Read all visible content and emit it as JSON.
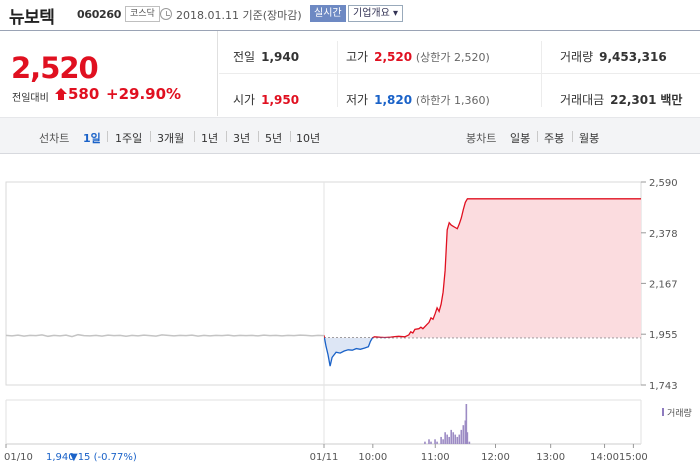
{
  "header": {
    "stock_name": "뉴보텍",
    "stock_code": "060260",
    "market": "코스닥",
    "date_text": "2018.01.11  기준(장마감)",
    "realtime_label": "실시간",
    "company_info_label": "기업개요",
    "company_info_arrow": "▾"
  },
  "summary": {
    "current_price": "2,520",
    "compare_label": "전일대비",
    "change": "580",
    "change_pct": "+29.90%",
    "prev_label": "전일",
    "prev_value": "1,940",
    "high_label": "고가",
    "high_value": "2,520",
    "high_limit": "(상한가 2,520)",
    "volume_label": "거래량",
    "volume_value": "9,453,316",
    "open_label": "시가",
    "open_value": "1,950",
    "low_label": "저가",
    "low_value": "1,820",
    "low_limit": "(하한가 1,360)",
    "amount_label": "거래대금",
    "amount_value": "22,301",
    "amount_unit": "백만"
  },
  "period_tabs": {
    "line_label": "선차트",
    "line_items": [
      "1일",
      "1주일",
      "3개월",
      "1년",
      "3년",
      "5년",
      "10년"
    ],
    "active": "1일",
    "candle_label": "봉차트",
    "candle_items": [
      "일봉",
      "주봉",
      "월봉"
    ]
  },
  "colors": {
    "up": "#e01020",
    "down": "#1a62c8",
    "accent": "#6d89c3"
  },
  "chart_data": {
    "type": "line",
    "y_ticks": [
      "2,590",
      "2,378",
      "2,167",
      "1,955",
      "1,743"
    ],
    "ylim": [
      1743,
      2590
    ],
    "baseline": 1940,
    "x_ticks": [
      "01/11",
      "10:00",
      "11:00",
      "12:00",
      "13:00",
      "14:00",
      "15:00"
    ],
    "prev_day_label": "01/10",
    "prev_day_price": "1,940",
    "prev_day_change": "▼15 (-0.77%)",
    "volume_legend": "거래량",
    "prev_day_series": [
      [
        0,
        1950
      ],
      [
        6,
        1948
      ],
      [
        12,
        1951
      ],
      [
        18,
        1947
      ],
      [
        24,
        1950
      ],
      [
        30,
        1949
      ],
      [
        36,
        1952
      ],
      [
        42,
        1946
      ],
      [
        48,
        1950
      ],
      [
        54,
        1948
      ],
      [
        60,
        1951
      ],
      [
        66,
        1945
      ],
      [
        72,
        1953
      ],
      [
        78,
        1949
      ],
      [
        84,
        1948
      ],
      [
        90,
        1950
      ],
      [
        96,
        1947
      ],
      [
        102,
        1951
      ],
      [
        108,
        1949
      ],
      [
        114,
        1950
      ],
      [
        120,
        1946
      ],
      [
        126,
        1950
      ],
      [
        132,
        1948
      ],
      [
        138,
        1951
      ],
      [
        144,
        1949
      ],
      [
        150,
        1947
      ],
      [
        156,
        1952
      ],
      [
        162,
        1950
      ],
      [
        168,
        1948
      ],
      [
        174,
        1950
      ],
      [
        180,
        1949
      ],
      [
        186,
        1951
      ],
      [
        192,
        1947
      ],
      [
        198,
        1950
      ],
      [
        204,
        1948
      ],
      [
        210,
        1950
      ],
      [
        216,
        1949
      ],
      [
        222,
        1951
      ],
      [
        228,
        1948
      ],
      [
        234,
        1950
      ],
      [
        240,
        1949
      ],
      [
        246,
        1950
      ],
      [
        252,
        1948
      ],
      [
        258,
        1951
      ],
      [
        264,
        1949
      ],
      [
        270,
        1950
      ],
      [
        276,
        1948
      ],
      [
        282,
        1950
      ],
      [
        288,
        1949
      ],
      [
        294,
        1951
      ],
      [
        300,
        1950
      ],
      [
        306,
        1948
      ],
      [
        312,
        1950
      ],
      [
        318,
        1949
      ]
    ],
    "today_series": [
      [
        0,
        1950
      ],
      [
        2,
        1905
      ],
      [
        4,
        1870
      ],
      [
        6,
        1822
      ],
      [
        8,
        1858
      ],
      [
        12,
        1880
      ],
      [
        16,
        1876
      ],
      [
        20,
        1885
      ],
      [
        24,
        1890
      ],
      [
        28,
        1888
      ],
      [
        32,
        1895
      ],
      [
        36,
        1892
      ],
      [
        40,
        1897
      ],
      [
        44,
        1903
      ],
      [
        46,
        1925
      ],
      [
        48,
        1940
      ],
      [
        50,
        1944
      ],
      [
        56,
        1942
      ],
      [
        60,
        1941
      ],
      [
        66,
        1943
      ],
      [
        70,
        1945
      ],
      [
        74,
        1946
      ],
      [
        80,
        1944
      ],
      [
        84,
        1952
      ],
      [
        86,
        1965
      ],
      [
        88,
        1960
      ],
      [
        90,
        1975
      ],
      [
        94,
        1978
      ],
      [
        96,
        1984
      ],
      [
        98,
        1978
      ],
      [
        102,
        1996
      ],
      [
        104,
        2004
      ],
      [
        106,
        2023
      ],
      [
        108,
        2017
      ],
      [
        110,
        2040
      ],
      [
        112,
        2065
      ],
      [
        114,
        2050
      ],
      [
        116,
        2080
      ],
      [
        118,
        2130
      ],
      [
        120,
        2220
      ],
      [
        122,
        2390
      ],
      [
        124,
        2420
      ],
      [
        126,
        2410
      ],
      [
        128,
        2405
      ],
      [
        130,
        2400
      ],
      [
        132,
        2395
      ],
      [
        134,
        2415
      ],
      [
        136,
        2440
      ],
      [
        138,
        2475
      ],
      [
        140,
        2505
      ],
      [
        142,
        2520
      ],
      [
        314,
        2520
      ]
    ],
    "volume_series": [
      [
        100,
        1
      ],
      [
        104,
        2
      ],
      [
        106,
        1
      ],
      [
        110,
        2
      ],
      [
        112,
        1
      ],
      [
        116,
        3
      ],
      [
        118,
        2
      ],
      [
        120,
        5
      ],
      [
        122,
        4
      ],
      [
        124,
        3
      ],
      [
        126,
        6
      ],
      [
        128,
        5
      ],
      [
        130,
        4
      ],
      [
        132,
        3
      ],
      [
        134,
        4
      ],
      [
        136,
        6
      ],
      [
        138,
        8
      ],
      [
        140,
        10
      ],
      [
        141,
        17
      ],
      [
        142,
        5
      ],
      [
        144,
        1
      ]
    ]
  }
}
